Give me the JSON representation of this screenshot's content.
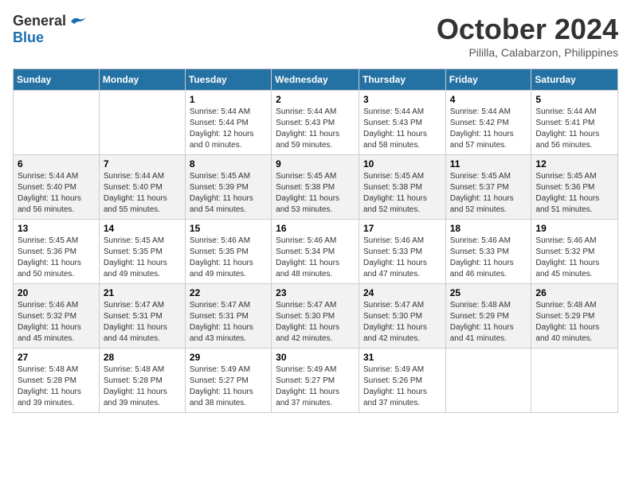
{
  "header": {
    "logo_general": "General",
    "logo_blue": "Blue",
    "month": "October 2024",
    "location": "Pililla, Calabarzon, Philippines"
  },
  "days_of_week": [
    "Sunday",
    "Monday",
    "Tuesday",
    "Wednesday",
    "Thursday",
    "Friday",
    "Saturday"
  ],
  "weeks": [
    [
      {
        "day": "",
        "info": ""
      },
      {
        "day": "",
        "info": ""
      },
      {
        "day": "1",
        "info": "Sunrise: 5:44 AM\nSunset: 5:44 PM\nDaylight: 12 hours and 0 minutes."
      },
      {
        "day": "2",
        "info": "Sunrise: 5:44 AM\nSunset: 5:43 PM\nDaylight: 11 hours and 59 minutes."
      },
      {
        "day": "3",
        "info": "Sunrise: 5:44 AM\nSunset: 5:43 PM\nDaylight: 11 hours and 58 minutes."
      },
      {
        "day": "4",
        "info": "Sunrise: 5:44 AM\nSunset: 5:42 PM\nDaylight: 11 hours and 57 minutes."
      },
      {
        "day": "5",
        "info": "Sunrise: 5:44 AM\nSunset: 5:41 PM\nDaylight: 11 hours and 56 minutes."
      }
    ],
    [
      {
        "day": "6",
        "info": "Sunrise: 5:44 AM\nSunset: 5:40 PM\nDaylight: 11 hours and 56 minutes."
      },
      {
        "day": "7",
        "info": "Sunrise: 5:44 AM\nSunset: 5:40 PM\nDaylight: 11 hours and 55 minutes."
      },
      {
        "day": "8",
        "info": "Sunrise: 5:45 AM\nSunset: 5:39 PM\nDaylight: 11 hours and 54 minutes."
      },
      {
        "day": "9",
        "info": "Sunrise: 5:45 AM\nSunset: 5:38 PM\nDaylight: 11 hours and 53 minutes."
      },
      {
        "day": "10",
        "info": "Sunrise: 5:45 AM\nSunset: 5:38 PM\nDaylight: 11 hours and 52 minutes."
      },
      {
        "day": "11",
        "info": "Sunrise: 5:45 AM\nSunset: 5:37 PM\nDaylight: 11 hours and 52 minutes."
      },
      {
        "day": "12",
        "info": "Sunrise: 5:45 AM\nSunset: 5:36 PM\nDaylight: 11 hours and 51 minutes."
      }
    ],
    [
      {
        "day": "13",
        "info": "Sunrise: 5:45 AM\nSunset: 5:36 PM\nDaylight: 11 hours and 50 minutes."
      },
      {
        "day": "14",
        "info": "Sunrise: 5:45 AM\nSunset: 5:35 PM\nDaylight: 11 hours and 49 minutes."
      },
      {
        "day": "15",
        "info": "Sunrise: 5:46 AM\nSunset: 5:35 PM\nDaylight: 11 hours and 49 minutes."
      },
      {
        "day": "16",
        "info": "Sunrise: 5:46 AM\nSunset: 5:34 PM\nDaylight: 11 hours and 48 minutes."
      },
      {
        "day": "17",
        "info": "Sunrise: 5:46 AM\nSunset: 5:33 PM\nDaylight: 11 hours and 47 minutes."
      },
      {
        "day": "18",
        "info": "Sunrise: 5:46 AM\nSunset: 5:33 PM\nDaylight: 11 hours and 46 minutes."
      },
      {
        "day": "19",
        "info": "Sunrise: 5:46 AM\nSunset: 5:32 PM\nDaylight: 11 hours and 45 minutes."
      }
    ],
    [
      {
        "day": "20",
        "info": "Sunrise: 5:46 AM\nSunset: 5:32 PM\nDaylight: 11 hours and 45 minutes."
      },
      {
        "day": "21",
        "info": "Sunrise: 5:47 AM\nSunset: 5:31 PM\nDaylight: 11 hours and 44 minutes."
      },
      {
        "day": "22",
        "info": "Sunrise: 5:47 AM\nSunset: 5:31 PM\nDaylight: 11 hours and 43 minutes."
      },
      {
        "day": "23",
        "info": "Sunrise: 5:47 AM\nSunset: 5:30 PM\nDaylight: 11 hours and 42 minutes."
      },
      {
        "day": "24",
        "info": "Sunrise: 5:47 AM\nSunset: 5:30 PM\nDaylight: 11 hours and 42 minutes."
      },
      {
        "day": "25",
        "info": "Sunrise: 5:48 AM\nSunset: 5:29 PM\nDaylight: 11 hours and 41 minutes."
      },
      {
        "day": "26",
        "info": "Sunrise: 5:48 AM\nSunset: 5:29 PM\nDaylight: 11 hours and 40 minutes."
      }
    ],
    [
      {
        "day": "27",
        "info": "Sunrise: 5:48 AM\nSunset: 5:28 PM\nDaylight: 11 hours and 39 minutes."
      },
      {
        "day": "28",
        "info": "Sunrise: 5:48 AM\nSunset: 5:28 PM\nDaylight: 11 hours and 39 minutes."
      },
      {
        "day": "29",
        "info": "Sunrise: 5:49 AM\nSunset: 5:27 PM\nDaylight: 11 hours and 38 minutes."
      },
      {
        "day": "30",
        "info": "Sunrise: 5:49 AM\nSunset: 5:27 PM\nDaylight: 11 hours and 37 minutes."
      },
      {
        "day": "31",
        "info": "Sunrise: 5:49 AM\nSunset: 5:26 PM\nDaylight: 11 hours and 37 minutes."
      },
      {
        "day": "",
        "info": ""
      },
      {
        "day": "",
        "info": ""
      }
    ]
  ]
}
